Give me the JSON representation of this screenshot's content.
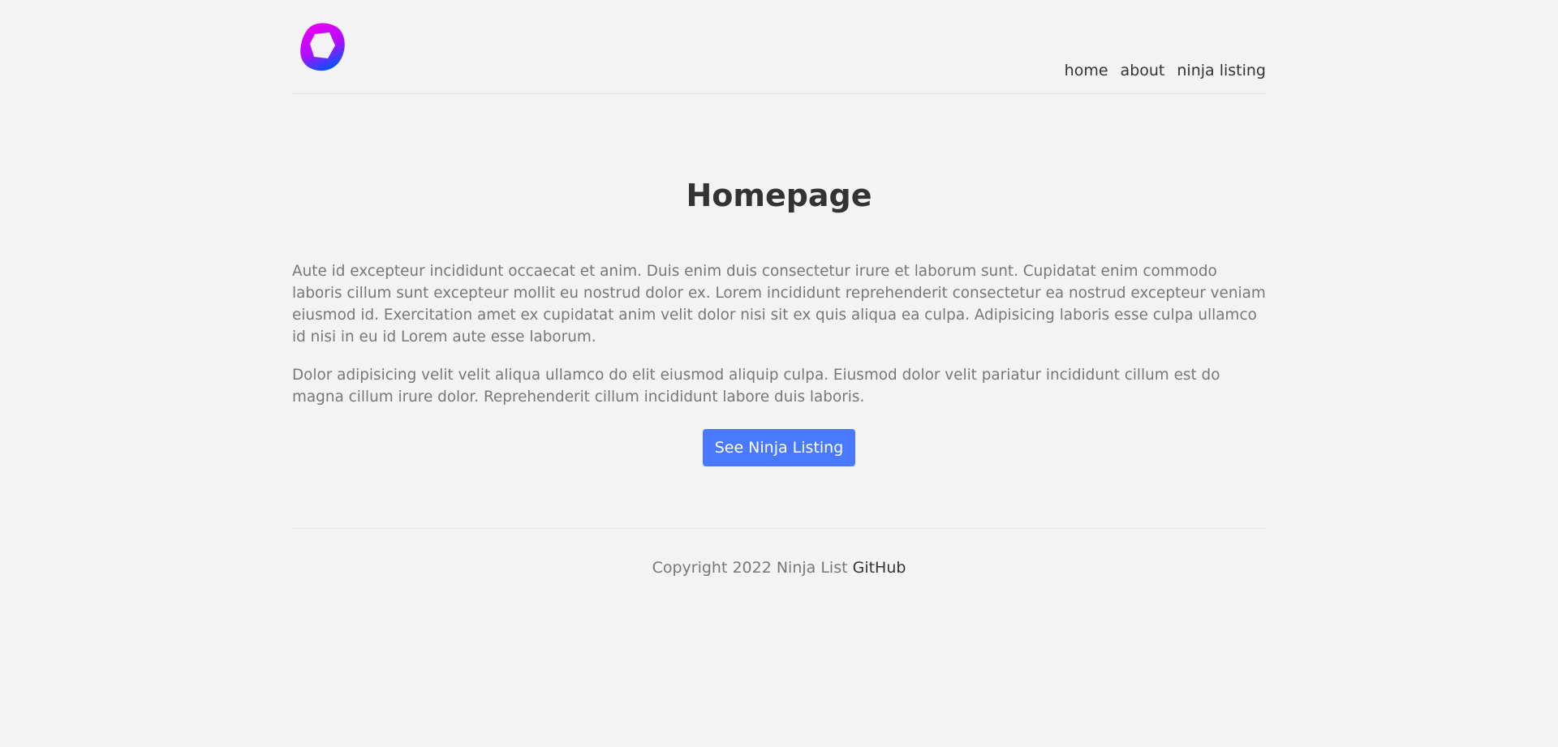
{
  "nav": {
    "logo_icon": "gradient-ring-logo-icon",
    "links": [
      {
        "label": "home"
      },
      {
        "label": "about"
      },
      {
        "label": "ninja listing"
      }
    ]
  },
  "main": {
    "title": "Homepage",
    "paragraphs": [
      "Aute id excepteur incididunt occaecat et anim. Duis enim duis consectetur irure et laborum sunt. Cupidatat enim commodo laboris cillum sunt excepteur mollit eu nostrud dolor ex. Lorem incididunt reprehenderit consectetur ea nostrud excepteur veniam eiusmod id. Exercitation amet ex cupidatat anim velit dolor nisi sit ex quis aliqua ea culpa. Adipisicing laboris esse culpa ullamco id nisi in eu id Lorem aute esse laborum.",
      "Dolor adipisicing velit velit aliqua ullamco do elit eiusmod aliquip culpa. Eiusmod dolor velit pariatur incididunt cillum est do magna cillum irure dolor. Reprehenderit cillum incididunt labore duis laboris."
    ],
    "cta_label": "See Ninja Listing"
  },
  "footer": {
    "copyright": "Copyright 2022 Ninja List",
    "github_label": "GitHub"
  },
  "colors": {
    "background": "#f3f3f3",
    "accent": "#4979ff",
    "text": "#333333",
    "muted_text": "#777777",
    "logo_gradient": [
      "#ee00ee",
      "#0055ff"
    ]
  }
}
